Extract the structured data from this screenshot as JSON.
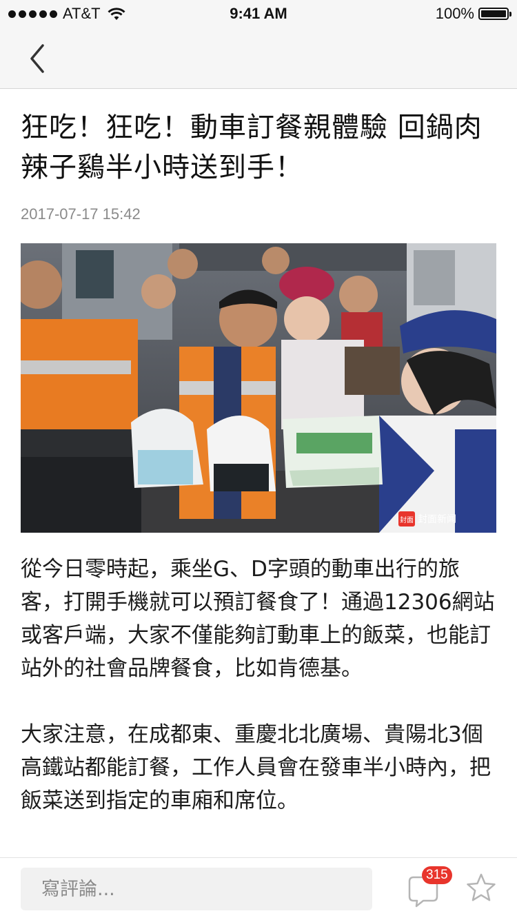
{
  "status_bar": {
    "carrier": "AT&T",
    "time": "9:41 AM",
    "battery": "100%",
    "battery_level": 1.0
  },
  "navbar": {
    "back_icon": "chevron-left-icon"
  },
  "article": {
    "title": "狂吃！狂吃！動車訂餐親體驗 回鍋肉辣子鷄半小時送到手！",
    "date": "2017-07-17 15:42",
    "image_watermark": "封面新闻",
    "paragraphs": [
      "從今日零時起，乘坐G、D字頭的動車出行的旅客，打開手機就可以預訂餐食了！通過12306網站或客戶端，大家不僅能夠訂動車上的飯菜，也能訂站外的社會品牌餐食，比如肯德基。",
      "大家注意，在成都東、重慶北北廣場、貴陽北3個高鐵站都能訂餐，工作人員會在發車半小時內，把飯菜送到指定的車廂和席位。"
    ]
  },
  "bottom_bar": {
    "comment_placeholder": "寫評論...",
    "comment_count": "315",
    "comment_icon": "comment-bubble-icon",
    "favorite_icon": "star-icon"
  },
  "colors": {
    "badge": "#e8352c",
    "bar_background": "#f6f6f6",
    "date_text": "#8a8a8a"
  }
}
